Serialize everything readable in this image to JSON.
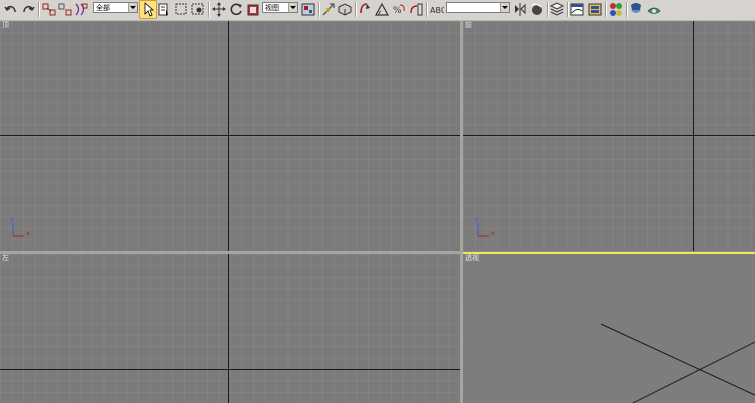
{
  "toolbar": {
    "selection_filter": "全部",
    "reference_coord": "视图",
    "named_selection": ""
  },
  "viewports": {
    "top_left": {
      "label": "顶"
    },
    "top_right": {
      "label": "前"
    },
    "bottom_left": {
      "label": "左"
    },
    "bottom_right": {
      "label": "透视"
    }
  },
  "gizmo": {
    "x_label": "x",
    "y_label": "y"
  },
  "colors": {
    "active_border": "#f2e65a",
    "viewport_bg": "#7b7b7b",
    "toolbar_bg": "#d6d3ce"
  }
}
